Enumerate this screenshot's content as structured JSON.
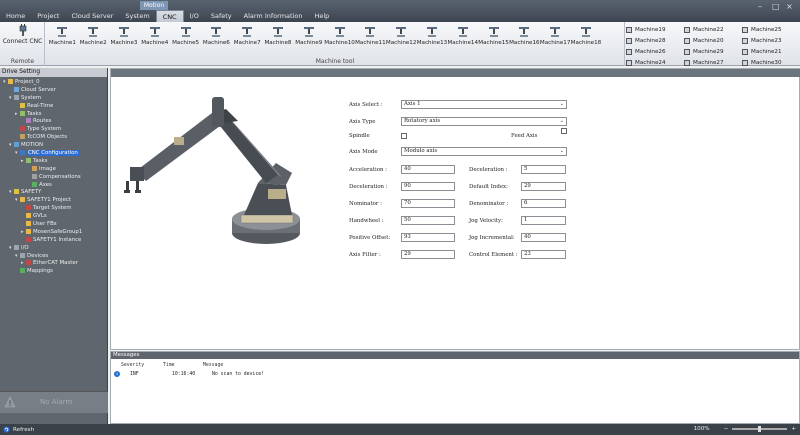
{
  "menu": {
    "items": [
      "Home",
      "Project",
      "Cloud Server",
      "System",
      "CNC",
      "I/O",
      "Safety",
      "Alarm Information",
      "Help"
    ],
    "active": "CNC",
    "tag": "Motion"
  },
  "ribbon": {
    "connect_label": "Connect CNC",
    "remote_group": "Remote",
    "machine_group": "Machine tool",
    "machines": [
      "Machine1",
      "Machine2",
      "Machine3",
      "Machine4",
      "Machine5",
      "Machine6",
      "Machine7",
      "Machine8",
      "Machine9",
      "Machine10",
      "Machine11",
      "Machine12",
      "Machine13",
      "Machine14",
      "Machine15",
      "Machine16",
      "Machine17",
      "Machine18"
    ],
    "small_machines": [
      "Machine19",
      "Machine22",
      "Machine25",
      "Machine28",
      "Machine20",
      "Machine23",
      "Machine26",
      "Machine29",
      "Machine21",
      "Machine24",
      "Machine27",
      "Machine30"
    ]
  },
  "left_panel": {
    "title": "Drive Setting",
    "tree": [
      {
        "label": "Project_0",
        "depth": 0,
        "expander": "-",
        "icon": "folder-icon",
        "color": "#e8b84a"
      },
      {
        "label": "Cloud Server",
        "depth": 1,
        "expander": "",
        "icon": "cloud-icon",
        "color": "#6fa8e0"
      },
      {
        "label": "System",
        "depth": 1,
        "expander": "-",
        "icon": "system-icon",
        "color": "#9aa5b1"
      },
      {
        "label": "Real-Time",
        "depth": 2,
        "expander": "",
        "icon": "clock-icon",
        "color": "#e0c040"
      },
      {
        "label": "Tasks",
        "depth": 2,
        "expander": "+",
        "icon": "tasks-icon",
        "color": "#8fbf6a"
      },
      {
        "label": "Routes",
        "depth": 3,
        "expander": "",
        "icon": "route-icon",
        "color": "#b07fc0"
      },
      {
        "label": "Type System",
        "depth": 2,
        "expander": "",
        "icon": "type-icon",
        "color": "#c04848"
      },
      {
        "label": "TcCOM Objects",
        "depth": 2,
        "expander": "",
        "icon": "object-icon",
        "color": "#c0a060"
      },
      {
        "label": "MOTION",
        "depth": 1,
        "expander": "-",
        "icon": "motion-icon",
        "color": "#5fa0d8"
      },
      {
        "label": "CNC Configuration",
        "depth": 2,
        "expander": "-",
        "icon": "cnc-icon",
        "color": "#3b78c8",
        "selected": true
      },
      {
        "label": "Tasks",
        "depth": 3,
        "expander": "+",
        "icon": "tasks-icon",
        "color": "#8fbf6a"
      },
      {
        "label": "Image",
        "depth": 4,
        "expander": "",
        "icon": "image-icon",
        "color": "#d0a050"
      },
      {
        "label": "Compensations",
        "depth": 4,
        "expander": "",
        "icon": "compensation-icon",
        "color": "#a0a0a0"
      },
      {
        "label": "Axes",
        "depth": 4,
        "expander": "",
        "icon": "axes-icon",
        "color": "#58b060"
      },
      {
        "label": "SAFETY",
        "depth": 1,
        "expander": "-",
        "icon": "safety-icon",
        "color": "#e0c040"
      },
      {
        "label": "SAFETY1 Project",
        "depth": 2,
        "expander": "-",
        "icon": "safety-project-icon",
        "color": "#e8b84a"
      },
      {
        "label": "Target System",
        "depth": 3,
        "expander": "",
        "icon": "target-icon",
        "color": "#c04848"
      },
      {
        "label": "GVLs",
        "depth": 3,
        "expander": "",
        "icon": "folder-icon",
        "color": "#e8b84a"
      },
      {
        "label": "User FBs",
        "depth": 3,
        "expander": "",
        "icon": "folder-icon",
        "color": "#e8b84a"
      },
      {
        "label": "MosenSafeGroup1",
        "depth": 3,
        "expander": "+",
        "icon": "folder-icon",
        "color": "#e8b84a"
      },
      {
        "label": "SAFETY1 Instance",
        "depth": 3,
        "expander": "",
        "icon": "instance-icon",
        "color": "#c04848"
      },
      {
        "label": "I/O",
        "depth": 1,
        "expander": "-",
        "icon": "io-icon",
        "color": "#9aa5b1"
      },
      {
        "label": "Devices",
        "depth": 2,
        "expander": "-",
        "icon": "devices-icon",
        "color": "#9aa5b1"
      },
      {
        "label": "EtherCAT Master",
        "depth": 3,
        "expander": "+",
        "icon": "ethercat-icon",
        "color": "#c04848"
      },
      {
        "label": "Mappings",
        "depth": 2,
        "expander": "",
        "icon": "mappings-icon",
        "color": "#58b060"
      }
    ],
    "alarm": "No Alarm"
  },
  "form": {
    "axis_select_label": "Axis Select :",
    "axis_select_value": "Axis 1",
    "axis_type_label": "Axis Type",
    "axis_type_value": "Rotatory axis",
    "spindle_label": "Spindle",
    "feed_axis_label": "Feed Axis",
    "axis_mode_label": "Axis Mode",
    "axis_mode_value": "Modulo axis",
    "left_fields": [
      {
        "label": "Acceleration :",
        "value": "40"
      },
      {
        "label": "Deceleration :",
        "value": "90"
      },
      {
        "label": "Nominator :",
        "value": "70"
      },
      {
        "label": "Handwheel :",
        "value": "50"
      },
      {
        "label": "Positive Offset:",
        "value": "93"
      },
      {
        "label": "Axis Filter :",
        "value": "29"
      }
    ],
    "right_fields": [
      {
        "label": "Deceleration :",
        "value": "5"
      },
      {
        "label": "Default Index:",
        "value": "29"
      },
      {
        "label": "Denominator :",
        "value": "6"
      },
      {
        "label": "Jog Velocity:",
        "value": "1"
      },
      {
        "label": "Jog Incremental:",
        "value": "40"
      },
      {
        "label": "Control Element :",
        "value": "23"
      }
    ]
  },
  "messages": {
    "title": "Messages",
    "col_severity": "Severity",
    "col_time": "Time",
    "col_message": "Message",
    "row": {
      "severity": "INF",
      "time": "10:16:40",
      "message": "No scan to device!"
    }
  },
  "status": {
    "left": "Refresh",
    "zoom": "100%"
  }
}
